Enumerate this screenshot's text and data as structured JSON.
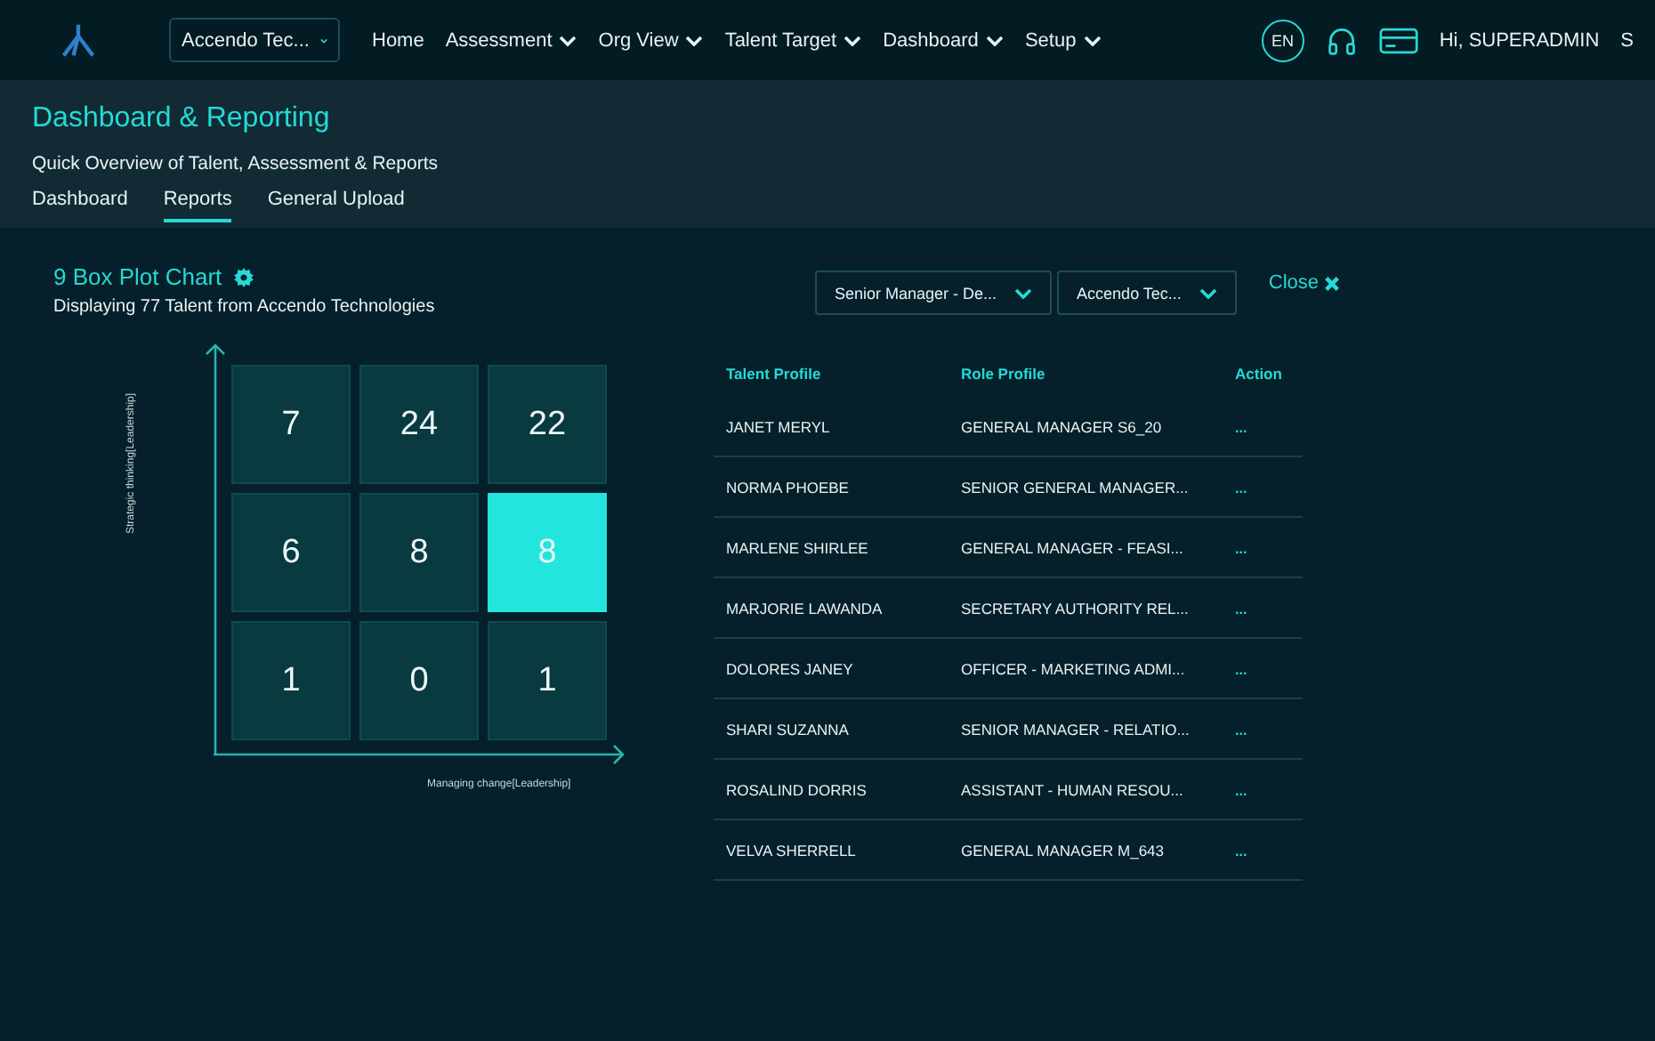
{
  "nav": {
    "company_select": "Accendo Tec...",
    "items": [
      {
        "label": "Home",
        "dropdown": false
      },
      {
        "label": "Assessment",
        "dropdown": true
      },
      {
        "label": "Org View",
        "dropdown": true
      },
      {
        "label": "Talent Target",
        "dropdown": true
      },
      {
        "label": "Dashboard",
        "dropdown": true
      },
      {
        "label": "Setup",
        "dropdown": true
      }
    ],
    "language": "EN",
    "greeting": "Hi, SUPERADMIN",
    "user_initial": "S"
  },
  "header": {
    "title": "Dashboard & Reporting",
    "subtitle": "Quick Overview of Talent, Assessment & Reports",
    "tabs": [
      {
        "label": "Dashboard",
        "selected": false
      },
      {
        "label": "Reports",
        "selected": true
      },
      {
        "label": "General Upload",
        "selected": false
      }
    ]
  },
  "chart": {
    "title": "9 Box Plot Chart",
    "subtitle": "Displaying 77 Talent from Accendo Technologies",
    "y_label": "Strategic thinking[Leadership]",
    "x_label": "Managing change[Leadership]",
    "cells": [
      {
        "value": "7",
        "selected": false
      },
      {
        "value": "24",
        "selected": false
      },
      {
        "value": "22",
        "selected": false
      },
      {
        "value": "6",
        "selected": false
      },
      {
        "value": "8",
        "selected": false
      },
      {
        "value": "8",
        "selected": true
      },
      {
        "value": "1",
        "selected": false
      },
      {
        "value": "0",
        "selected": false
      },
      {
        "value": "1",
        "selected": false
      }
    ]
  },
  "filters": [
    "Senior Manager - De...",
    "Accendo Tec..."
  ],
  "close": "Close",
  "table": {
    "columns": [
      "Talent Profile",
      "Role Profile",
      "Action"
    ],
    "rows": [
      {
        "talent": "JANET MERYL",
        "role": "GENERAL MANAGER S6_20",
        "action": "..."
      },
      {
        "talent": "NORMA PHOEBE",
        "role": "SENIOR GENERAL MANAGER...",
        "action": "..."
      },
      {
        "talent": "MARLENE SHIRLEE",
        "role": "GENERAL MANAGER - FEASI...",
        "action": "..."
      },
      {
        "talent": "MARJORIE LAWANDA",
        "role": "SECRETARY AUTHORITY REL...",
        "action": "..."
      },
      {
        "talent": "DOLORES JANEY",
        "role": "OFFICER - MARKETING ADMI...",
        "action": "..."
      },
      {
        "talent": "SHARI SUZANNA",
        "role": "SENIOR MANAGER - RELATIO...",
        "action": "..."
      },
      {
        "talent": "ROSALIND DORRIS",
        "role": "ASSISTANT - HUMAN RESOU...",
        "action": "..."
      },
      {
        "talent": "VELVA SHERRELL",
        "role": "GENERAL MANAGER M_643",
        "action": "..."
      }
    ]
  }
}
